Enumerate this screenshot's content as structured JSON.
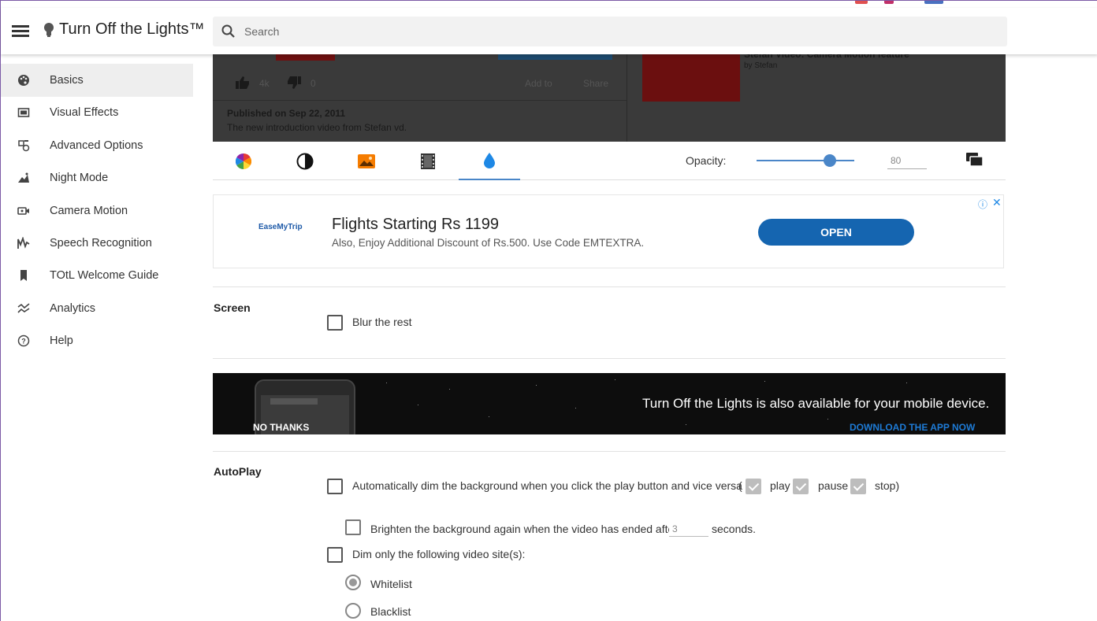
{
  "header": {
    "app_title": "Turn Off the Lights™",
    "search_placeholder": "Search"
  },
  "sidebar": {
    "items": [
      {
        "label": "Basics",
        "icon": "palette-icon",
        "active": true
      },
      {
        "label": "Visual Effects",
        "icon": "visual-effects-icon",
        "active": false
      },
      {
        "label": "Advanced Options",
        "icon": "advanced-options-icon",
        "active": false
      },
      {
        "label": "Night Mode",
        "icon": "night-mode-icon",
        "active": false
      },
      {
        "label": "Camera Motion",
        "icon": "camera-icon",
        "active": false
      },
      {
        "label": "Speech Recognition",
        "icon": "speech-icon",
        "active": false
      },
      {
        "label": "TOtL Welcome Guide",
        "icon": "bookmark-icon",
        "active": false
      },
      {
        "label": "Analytics",
        "icon": "analytics-icon",
        "active": false
      },
      {
        "label": "Help",
        "icon": "help-icon",
        "active": false
      }
    ]
  },
  "preview": {
    "likes": "4k",
    "dislikes": "0",
    "add_to": "Add to",
    "share": "Share",
    "published": "Published on Sep 22, 2011",
    "description": "The new introduction video from Stefan vd.",
    "related_title": "Stefan Video: Camera Motion feature",
    "related_by": "by Stefan"
  },
  "toolbar": {
    "tabs": [
      "color-wheel-icon",
      "contrast-icon",
      "image-icon",
      "film-icon",
      "opacity-drop-icon"
    ],
    "active_tab": 4,
    "opacity_label": "Opacity:",
    "opacity_value": "80",
    "opacity_level": 0.8
  },
  "ad": {
    "logo": "EaseMyTrip",
    "title": "Flights Starting Rs 1199",
    "subtitle": "Also, Enjoy Additional Discount of Rs.500. Use Code EMTEXTRA.",
    "button": "OPEN"
  },
  "screen": {
    "title": "Screen",
    "blur_label": "Blur the rest"
  },
  "mobile_banner": {
    "message": "Turn Off the Lights is also available for your mobile device.",
    "no_thanks": "NO THANKS",
    "download": "DOWNLOAD THE APP NOW"
  },
  "autoplay": {
    "title": "AutoPlay",
    "auto_dim_label": "Automatically dim the background when you click the play button and vice versa",
    "open_paren": "(",
    "play": "play",
    "pause": "pause",
    "stop": "stop)",
    "brighten_label": "Brighten the background again when the video has ended after",
    "brighten_seconds_value": "3",
    "seconds_label": "seconds.",
    "dim_only_label": "Dim only the following video site(s):",
    "whitelist": "Whitelist",
    "blacklist": "Blacklist"
  },
  "colors": {
    "accent": "#4a86c8",
    "ad_button": "#1565b0",
    "link": "#1e7bd6"
  }
}
